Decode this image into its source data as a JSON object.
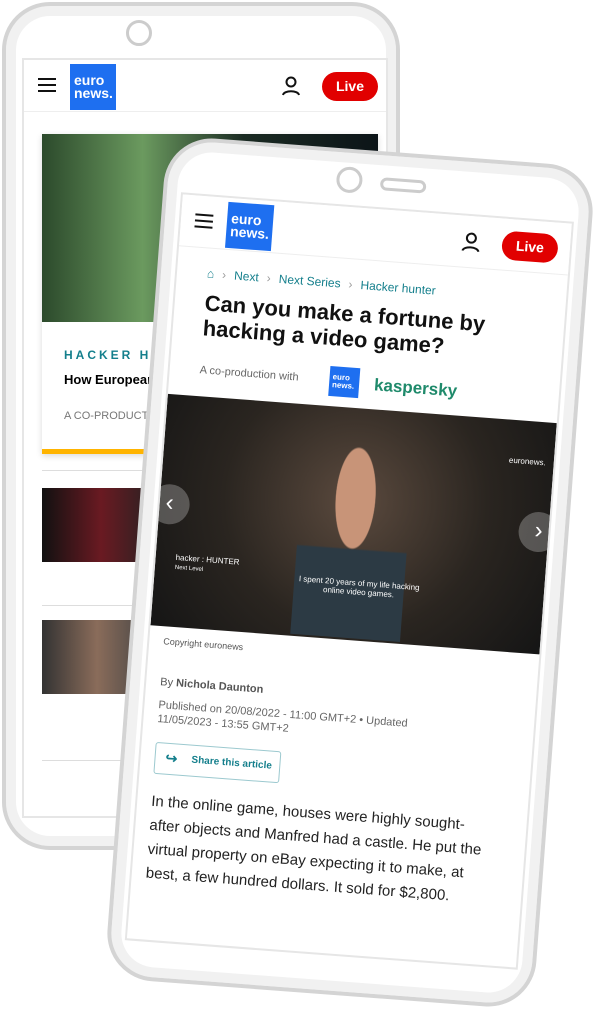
{
  "back_phone": {
    "live_label": "Live",
    "logo": "euronews.",
    "card1": {
      "kicker": "HACKER HUNTER",
      "title": "How European authorities fight child hacking",
      "meta": "A CO-PRODUCTION WITH KASPERSKY"
    }
  },
  "front_phone": {
    "live_label": "Live",
    "logo": "euronews.",
    "breadcrumb": [
      "Next",
      "Next Series",
      "Hacker hunter"
    ],
    "title": "Can you make a fortune by hacking a video game?",
    "coproduction_label": "A co-production with",
    "partner": "kaspersky",
    "video": {
      "watermark": "euronews.",
      "series_tag": "hacker : HUNTER",
      "series_sub": "Next   Level",
      "subtitle": "I spent 20 years of my life hacking online video games."
    },
    "copyright": "Copyright euronews",
    "byline_prefix": "By",
    "author": "Nichola Daunton",
    "published": "Published on 20/08/2022 - 11:00 GMT+2",
    "updated_label": "Updated",
    "updated": "11/05/2023 - 13:55 GMT+2",
    "share_label": "Share this article",
    "body": "In the online game, houses were highly sought-after objects and Manfred had a castle. He put the virtual property on eBay expecting it to make, at best, a few hundred dollars. It sold for $2,800."
  },
  "colors": {
    "brand": "#1e6ff0",
    "live": "#e10000",
    "teal": "#147f8c",
    "accent_bar": "#ffb400"
  }
}
